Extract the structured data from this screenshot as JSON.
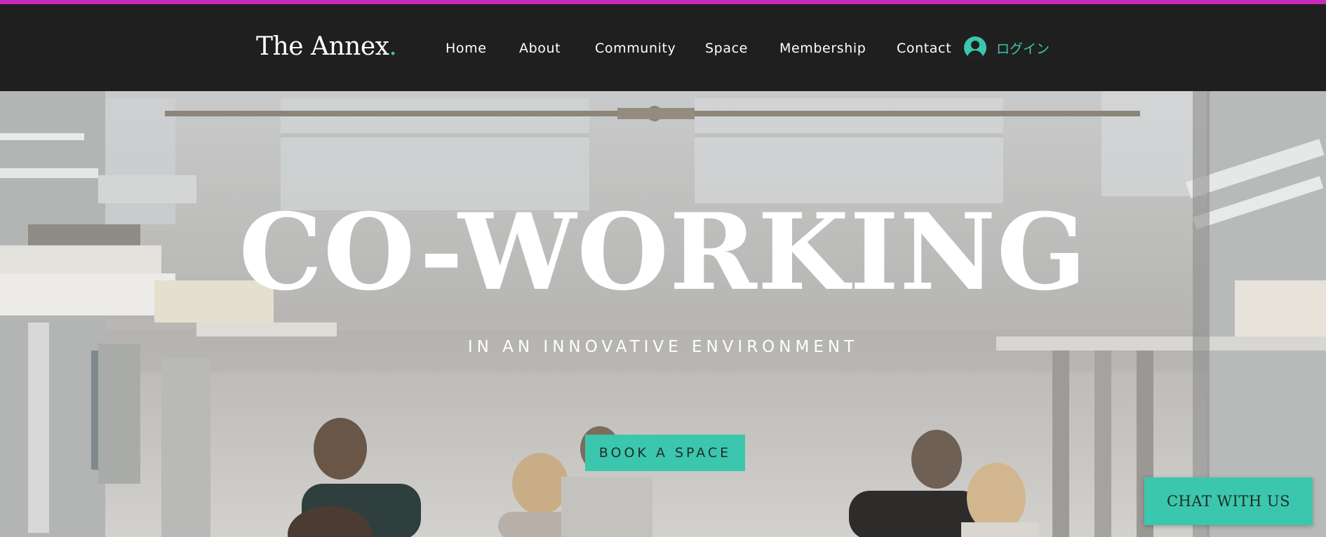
{
  "brand": {
    "name": "The Annex",
    "dot": ".",
    "accent_color": "#3bc7ad",
    "top_bar_color": "#c62ab8"
  },
  "nav": {
    "items": [
      {
        "label": "Home"
      },
      {
        "label": "About"
      },
      {
        "label": "Community"
      },
      {
        "label": "Space"
      },
      {
        "label": "Membership"
      },
      {
        "label": "Contact"
      }
    ],
    "login": {
      "icon": "account-circle-icon",
      "label": "ログイン"
    }
  },
  "hero": {
    "title": "CO-WORKING",
    "subtitle": "IN AN INNOVATIVE ENVIRONMENT",
    "cta_label": "BOOK A SPACE"
  },
  "chat": {
    "label": "CHAT WITH US"
  }
}
